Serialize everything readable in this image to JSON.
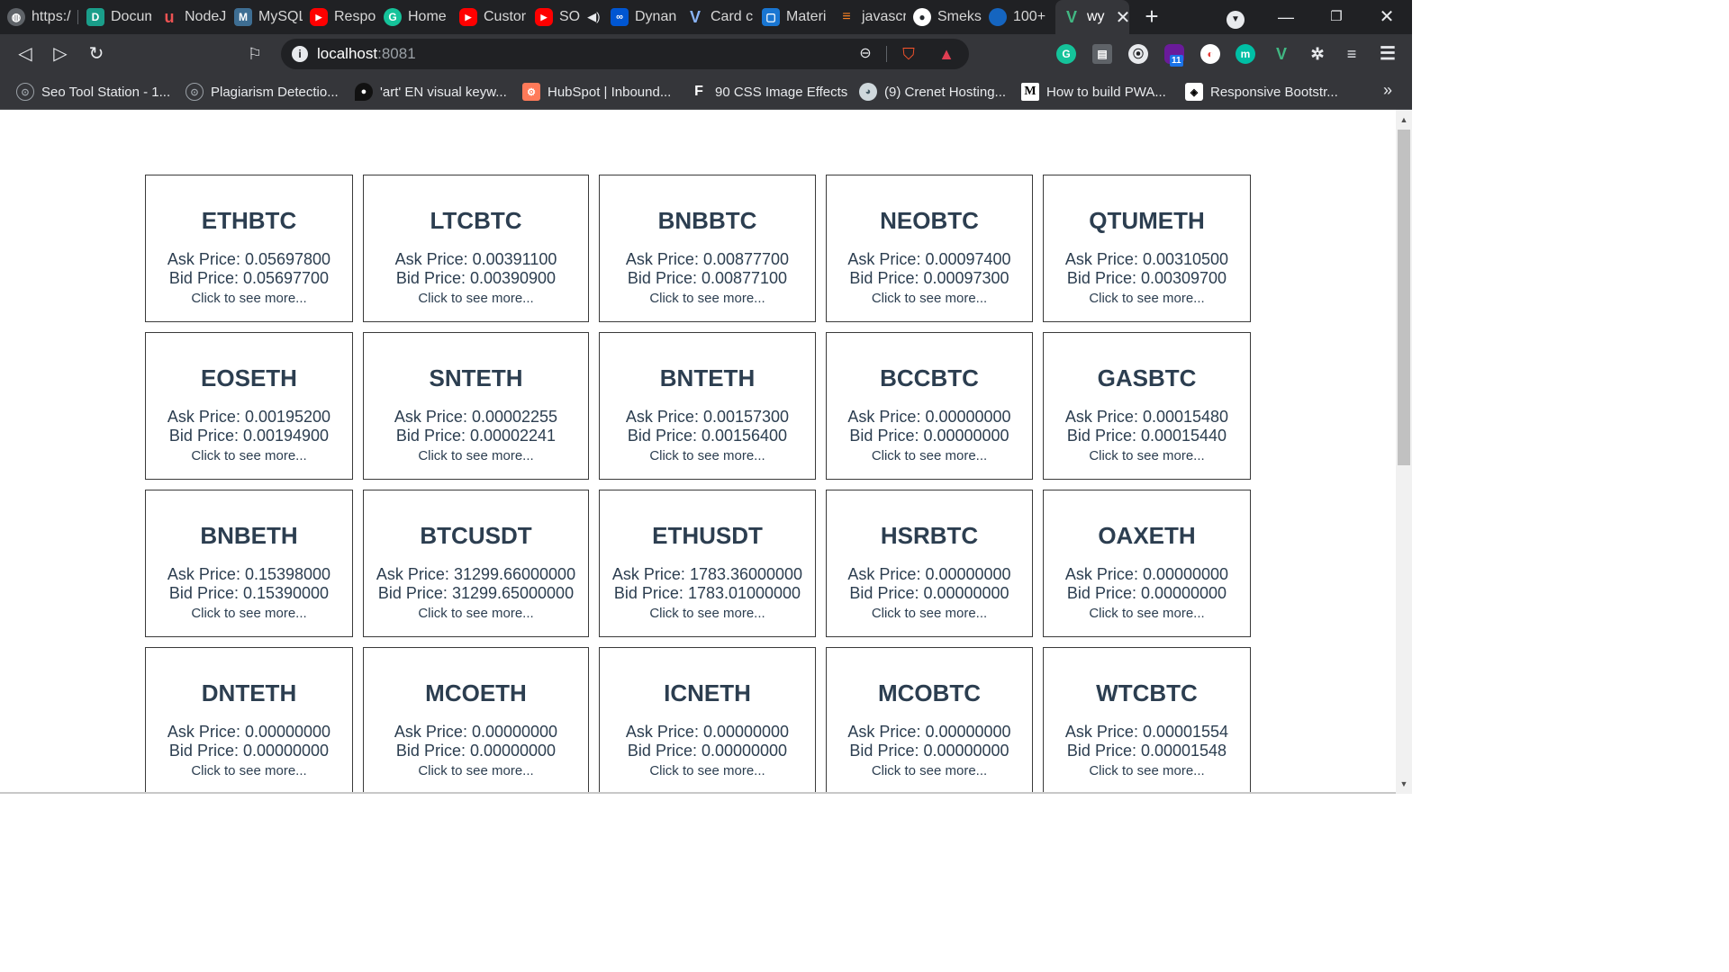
{
  "tabs": [
    {
      "label": "https:/",
      "icon": "globe-icon",
      "color": "#5f6368"
    },
    {
      "label": "Docum",
      "icon": "docs-icon",
      "color": "#1a9e8a"
    },
    {
      "label": "NodeJ",
      "icon": "udemy-icon",
      "color": "#a435f0"
    },
    {
      "label": "MySQL",
      "icon": "mysql-icon",
      "color": "#3e6e93"
    },
    {
      "label": "Respo",
      "icon": "youtube-icon",
      "color": "#ff0000"
    },
    {
      "label": "Home",
      "icon": "grammarly-icon",
      "color": "#15c39a"
    },
    {
      "label": "Custor",
      "icon": "youtube-icon",
      "color": "#ff0000"
    },
    {
      "label": "SO",
      "icon": "youtube-icon",
      "color": "#ff0000"
    },
    {
      "label": "Dynan",
      "icon": "coursera-icon",
      "color": "#0056d2"
    },
    {
      "label": "Card c",
      "icon": "vuetify-icon",
      "color": "#1867c0"
    },
    {
      "label": "Materi",
      "icon": "material-icon",
      "color": "#1976d2"
    },
    {
      "label": "javascr",
      "icon": "stackoverflow-icon",
      "color": "#f48024"
    },
    {
      "label": "Smeks",
      "icon": "github-icon",
      "color": "#24292e"
    },
    {
      "label": "100+",
      "icon": "circle-icon",
      "color": "#1565c0"
    },
    {
      "label": "wy",
      "icon": "vue-icon",
      "color": "#41b883"
    }
  ],
  "toolbar": {
    "url_host": "localhost",
    "url_port": ":8081",
    "extension_badge": "11"
  },
  "bookmarks": [
    {
      "label": "Seo Tool Station - 1...",
      "icon": "seo-icon"
    },
    {
      "label": "Plagiarism Detectio...",
      "icon": "plagiarism-icon"
    },
    {
      "label": "'art' EN visual keyw...",
      "icon": "art-icon"
    },
    {
      "label": "HubSpot | Inbound...",
      "icon": "hubspot-icon"
    },
    {
      "label": "90 CSS Image Effects",
      "icon": "f-icon"
    },
    {
      "label": "(9) Crenet Hosting...",
      "icon": "crenet-icon"
    },
    {
      "label": "How to build PWA...",
      "icon": "medium-icon"
    },
    {
      "label": "Responsive Bootstr...",
      "icon": "codepen-icon"
    }
  ],
  "labels": {
    "ask_prefix": "Ask Price: ",
    "bid_prefix": "Bid Price: ",
    "more": "Click to see more..."
  },
  "cards": [
    {
      "symbol": "ETHBTC",
      "ask": "0.05697800",
      "bid": "0.05697700"
    },
    {
      "symbol": "LTCBTC",
      "ask": "0.00391100",
      "bid": "0.00390900"
    },
    {
      "symbol": "BNBBTC",
      "ask": "0.00877700",
      "bid": "0.00877100"
    },
    {
      "symbol": "NEOBTC",
      "ask": "0.00097400",
      "bid": "0.00097300"
    },
    {
      "symbol": "QTUMETH",
      "ask": "0.00310500",
      "bid": "0.00309700"
    },
    {
      "symbol": "EOSETH",
      "ask": "0.00195200",
      "bid": "0.00194900"
    },
    {
      "symbol": "SNTETH",
      "ask": "0.00002255",
      "bid": "0.00002241"
    },
    {
      "symbol": "BNTETH",
      "ask": "0.00157300",
      "bid": "0.00156400"
    },
    {
      "symbol": "BCCBTC",
      "ask": "0.00000000",
      "bid": "0.00000000"
    },
    {
      "symbol": "GASBTC",
      "ask": "0.00015480",
      "bid": "0.00015440"
    },
    {
      "symbol": "BNBETH",
      "ask": "0.15398000",
      "bid": "0.15390000"
    },
    {
      "symbol": "BTCUSDT",
      "ask": "31299.66000000",
      "bid": "31299.65000000"
    },
    {
      "symbol": "ETHUSDT",
      "ask": "1783.36000000",
      "bid": "1783.01000000"
    },
    {
      "symbol": "HSRBTC",
      "ask": "0.00000000",
      "bid": "0.00000000"
    },
    {
      "symbol": "OAXETH",
      "ask": "0.00000000",
      "bid": "0.00000000"
    },
    {
      "symbol": "DNTETH",
      "ask": "0.00000000",
      "bid": "0.00000000"
    },
    {
      "symbol": "MCOETH",
      "ask": "0.00000000",
      "bid": "0.00000000"
    },
    {
      "symbol": "ICNETH",
      "ask": "0.00000000",
      "bid": "0.00000000"
    },
    {
      "symbol": "MCOBTC",
      "ask": "0.00000000",
      "bid": "0.00000000"
    },
    {
      "symbol": "WTCBTC",
      "ask": "0.00001554",
      "bid": "0.00001548"
    }
  ]
}
